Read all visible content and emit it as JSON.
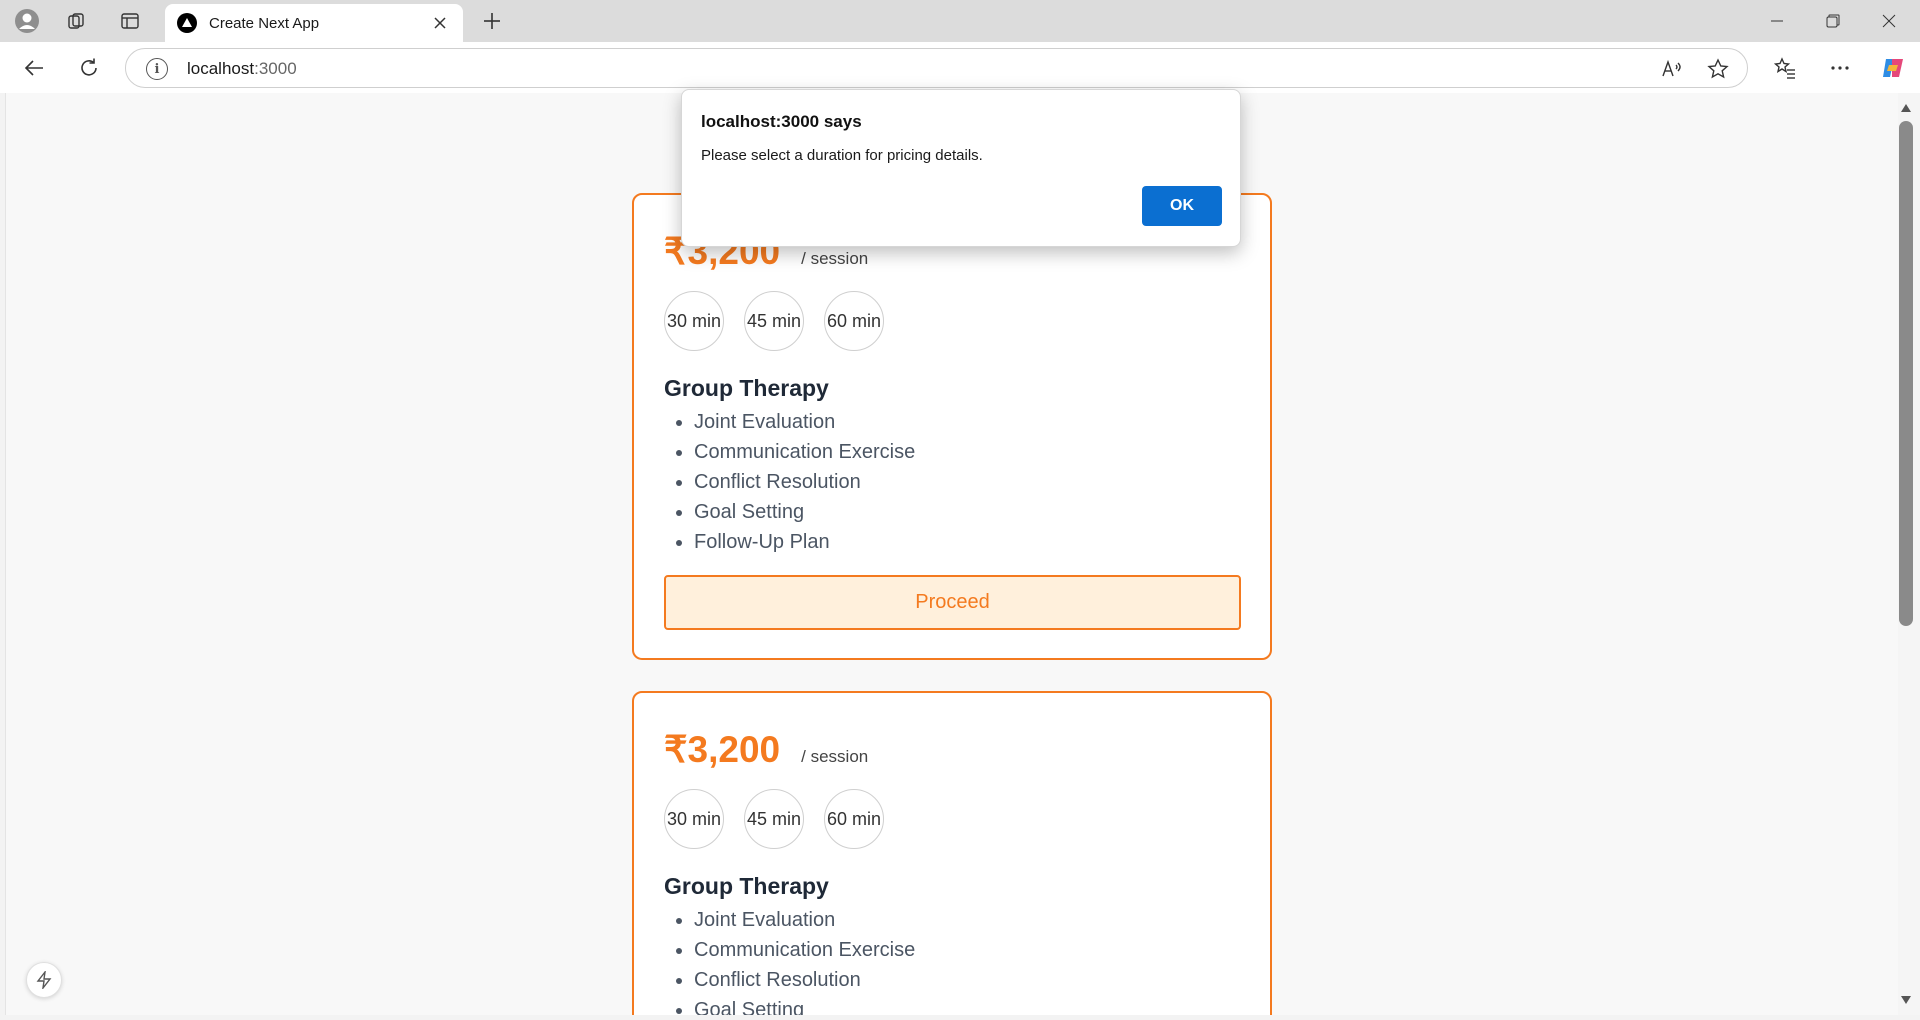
{
  "browser": {
    "tab_title": "Create Next App",
    "url_host": "localhost",
    "url_port": ":3000"
  },
  "cards": [
    {
      "price": "₹3,200",
      "per": "/ session",
      "durations": [
        "30 min",
        "45 min",
        "60 min"
      ],
      "title": "Group Therapy",
      "features": [
        "Joint Evaluation",
        "Communication Exercise",
        "Conflict Resolution",
        "Goal Setting",
        "Follow-Up Plan"
      ],
      "button": "Proceed"
    },
    {
      "price": "₹3,200",
      "per": "/ session",
      "durations": [
        "30 min",
        "45 min",
        "60 min"
      ],
      "title": "Group Therapy",
      "features": [
        "Joint Evaluation",
        "Communication Exercise",
        "Conflict Resolution",
        "Goal Setting"
      ]
    }
  ],
  "dialog": {
    "title": "localhost:3000 says",
    "message": "Please select a duration for pricing details.",
    "ok": "OK"
  },
  "colors": {
    "accent": "#f47a1f",
    "proceed_bg": "#fff0dc",
    "dialog_button": "#0b6fd1"
  }
}
